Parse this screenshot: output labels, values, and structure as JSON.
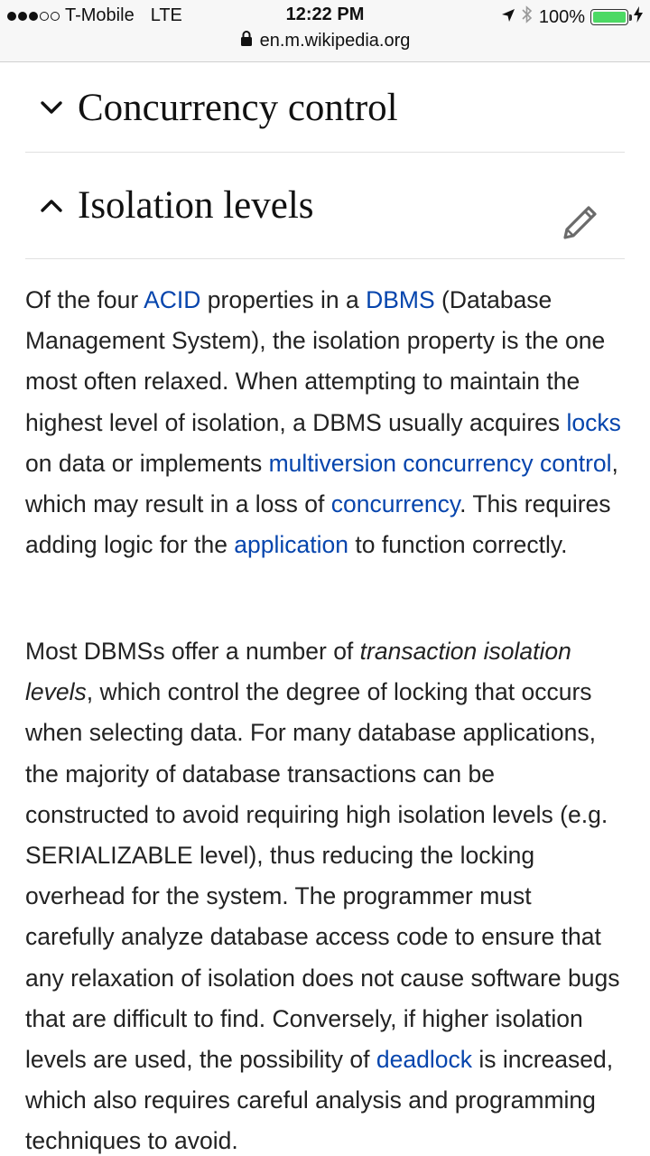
{
  "status_bar": {
    "carrier": "T-Mobile",
    "network": "LTE",
    "time": "12:22 PM",
    "battery": "100%",
    "battery_level": 1.0,
    "signal_bars": 3,
    "signal_total": 5
  },
  "url_bar": {
    "domain": "en.m.wikipedia.org"
  },
  "sections": {
    "concurrency": {
      "title": "Concurrency control",
      "state": "collapsed"
    },
    "isolation": {
      "title": "Isolation levels",
      "state": "expanded"
    }
  },
  "content": {
    "p1": {
      "t1": "Of the four ",
      "l1": "ACID",
      "t2": " properties in a ",
      "l2": "DBMS",
      "t3": " (Database Management System), the isolation property is the one most often relaxed. When attempting to maintain the highest level of isolation, a DBMS usually acquires ",
      "l3": "locks",
      "t4": " on data or implements ",
      "l4": "multiversion concurrency control",
      "t5": ", which may result in a loss of ",
      "l5": "concurrency",
      "t6": ". This requires adding logic for the ",
      "l6": "application",
      "t7": " to function correctly."
    },
    "p2": {
      "t1": "Most DBMSs offer a number of ",
      "em1": "transaction isolation levels",
      "t2": ", which control the degree of locking that occurs when selecting data. For many database applications, the majority of database transactions can be constructed to avoid requiring high isolation levels (e.g. SERIALIZABLE level), thus reducing the locking overhead for the system. The programmer must carefully analyze database access code to ensure that any relaxation of isolation does not cause software bugs that are difficult to find. Conversely, if higher isolation levels are used, the possibility of ",
      "l1": "deadlock",
      "t3": " is increased, which also requires careful analysis and programming techniques to avoid."
    }
  },
  "colors": {
    "link": "#0645ad",
    "text": "#222222",
    "battery": "#4cd964"
  }
}
